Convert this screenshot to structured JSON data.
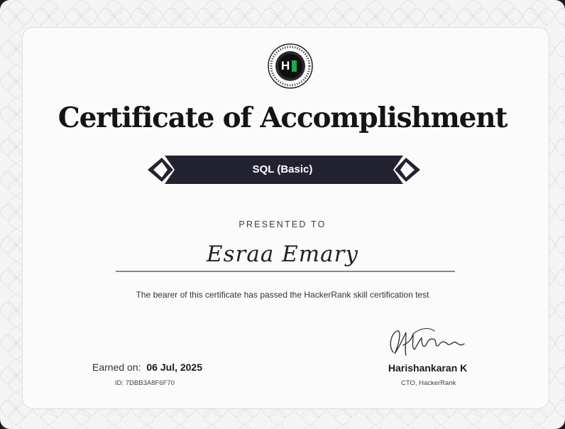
{
  "certificate": {
    "title": "Certificate of Accomplishment",
    "skill": "SQL (Basic)",
    "presented_to_label": "PRESENTED TO",
    "recipient_name": "Esraa Emary",
    "description": "The bearer of this certificate has passed the HackerRank skill certification test",
    "earned_label": "Earned on:",
    "earned_date": "06 Jul, 2025",
    "id_text": "ID: 7DBB3A8F6F70",
    "signer_name": "Harishankaran K",
    "signer_title": "CTO, HackerRank"
  },
  "logo": {
    "letter": "H",
    "icon": "hackerrank-logo-icon",
    "accent": "#1ba94c"
  },
  "colors": {
    "banner": "#222230",
    "frame": "#1c1c1c",
    "paper": "#fbfbfb"
  }
}
